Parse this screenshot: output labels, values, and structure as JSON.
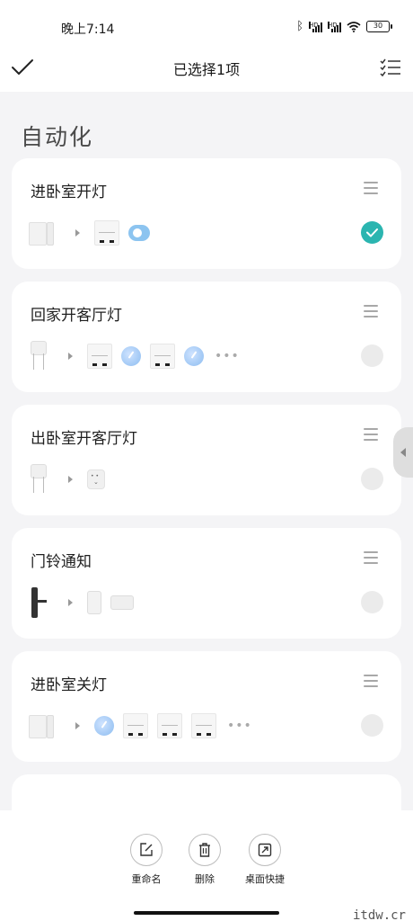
{
  "status_bar": {
    "time": "晚上7:14",
    "battery": "30"
  },
  "header": {
    "title": "已选择1项"
  },
  "section": {
    "title": "自动化"
  },
  "automations": [
    {
      "name": "进卧室开灯",
      "selected": true
    },
    {
      "name": "回家开客厅灯",
      "selected": false
    },
    {
      "name": "出卧室开客厅灯",
      "selected": false
    },
    {
      "name": "门铃通知",
      "selected": false
    },
    {
      "name": "进卧室关灯",
      "selected": false
    }
  ],
  "toolbar": {
    "rename": "重命名",
    "delete": "删除",
    "shortcut": "桌面快捷"
  },
  "watermark": "itdw.cr",
  "colors": {
    "accent": "#2bb5b0",
    "background": "#f4f4f6"
  }
}
